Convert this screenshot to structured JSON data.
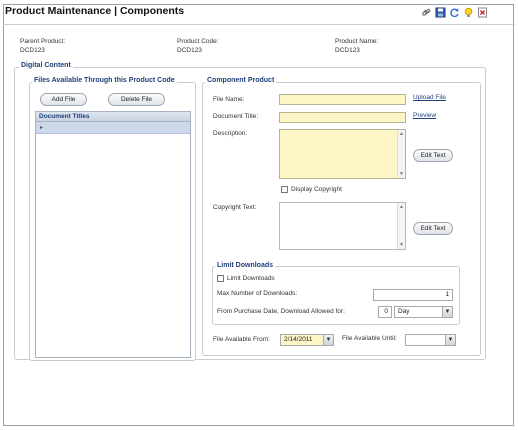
{
  "header": {
    "title": "Product Maintenance  |  Components",
    "icons": [
      "link-icon",
      "save-icon",
      "refresh-icon",
      "lightbulb-icon",
      "close-icon"
    ]
  },
  "product": {
    "parent_label": "Parent Product:",
    "parent_value": "DCD123",
    "code_label": "Product Code:",
    "code_value": "DCD123",
    "name_label": "Product Name:",
    "name_value": "DCD123"
  },
  "digital_content": {
    "legend": "Digital Content",
    "files_group": {
      "legend": "Files Available Through this Product Code",
      "add_label": "Add File",
      "delete_label": "Delete File",
      "grid_header": "Document Titles"
    },
    "component": {
      "legend": "Component Product",
      "file_name_label": "File Name:",
      "upload_label": "Upload File",
      "doc_title_label": "Document Title:",
      "preview_label": "Preview",
      "description_label": "Description:",
      "edit_text_label": "Edit Text",
      "display_copyright_label": "Display Copyright",
      "copyright_label": "Copyright Text:",
      "edit_text2_label": "Edit Text"
    },
    "limit": {
      "legend": "Limit Downloads",
      "checkbox_label": "Limit Downloads",
      "max_label": "Max Number of Downloads:",
      "max_value": "1",
      "purchase_label": "From Purchase Date, Download Allowed for:",
      "days_value": "0",
      "unit_value": "Day"
    },
    "availability": {
      "from_label": "File Available From:",
      "from_value": "2/14/2011",
      "until_label": "File Available Until:",
      "until_value": ""
    }
  },
  "colors": {
    "accent": "#1f3f7a",
    "input_yellow": "#fff6c8",
    "grid_row": "#cdd8ea"
  }
}
